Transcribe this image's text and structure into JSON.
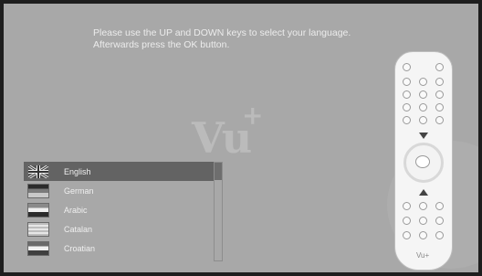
{
  "instructions": {
    "line1": "Please use the UP and DOWN keys to select your language.",
    "line2": "Afterwards press the OK button."
  },
  "watermark": {
    "text": "Vu",
    "plus": "+"
  },
  "languages": [
    {
      "label": "English",
      "flag": "uk-flag",
      "selected": true
    },
    {
      "label": "German",
      "flag": "de-flag",
      "selected": false
    },
    {
      "label": "Arabic",
      "flag": "ar-flag",
      "selected": false
    },
    {
      "label": "Catalan",
      "flag": "ca-flag",
      "selected": false
    },
    {
      "label": "Croatian",
      "flag": "hr-flag",
      "selected": false
    }
  ],
  "remote": {
    "brand": "Vu+"
  },
  "colors": {
    "background": "#a8a8a8",
    "selection": "#636363",
    "text": "#f0f0f0"
  }
}
